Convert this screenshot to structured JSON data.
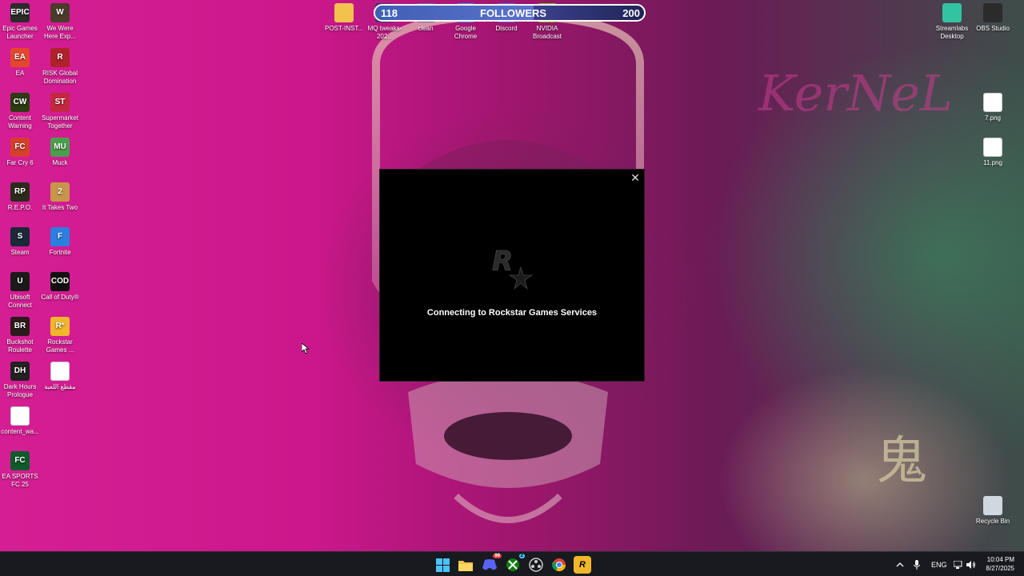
{
  "desktop": {
    "left_icons": [
      {
        "label": "Epic Games Launcher",
        "name": "epic-games-launcher-icon",
        "badge": "EPIC",
        "color": "#2b2b2b"
      },
      {
        "label": "We Were Here Exp...",
        "name": "we-were-here-icon",
        "badge": "W",
        "color": "#4a3b2b"
      },
      {
        "label": "EA",
        "name": "ea-icon",
        "badge": "EA",
        "color": "#e4472e"
      },
      {
        "label": "RISK Global Domination",
        "name": "risk-icon",
        "badge": "R",
        "color": "#b0222b"
      },
      {
        "label": "Content Warning",
        "name": "content-warning-icon",
        "badge": "CW",
        "color": "#2b3b12"
      },
      {
        "label": "Supermarket Together",
        "name": "supermarket-together-icon",
        "badge": "ST",
        "color": "#c42840"
      },
      {
        "label": "Far Cry 6",
        "name": "far-cry-6-icon",
        "badge": "FC",
        "color": "#d6402b"
      },
      {
        "label": "Muck",
        "name": "muck-icon",
        "badge": "MU",
        "color": "#4aa04a"
      },
      {
        "label": "R.E.P.O.",
        "name": "repo-icon",
        "badge": "RP",
        "color": "#2b2b1b"
      },
      {
        "label": "It Takes Two",
        "name": "it-takes-two-icon",
        "badge": "2",
        "color": "#c8964a"
      },
      {
        "label": "Steam",
        "name": "steam-icon",
        "badge": "S",
        "color": "#1b2838"
      },
      {
        "label": "Fortnite",
        "name": "fortnite-icon",
        "badge": "F",
        "color": "#2a7fe0"
      },
      {
        "label": "Ubisoft Connect",
        "name": "ubisoft-connect-icon",
        "badge": "U",
        "color": "#1a1a1a"
      },
      {
        "label": "Call of Duty®",
        "name": "call-of-duty-icon",
        "badge": "COD",
        "color": "#111111"
      },
      {
        "label": "Buckshot Roulette",
        "name": "buckshot-roulette-icon",
        "badge": "BR",
        "color": "#2b1b1b"
      },
      {
        "label": "Rockstar Games ...",
        "name": "rockstar-games-icon",
        "badge": "R*",
        "color": "#f2b62b"
      },
      {
        "label": "Dark Hours Prologue",
        "name": "dark-hours-icon",
        "badge": "DH",
        "color": "#222222"
      },
      {
        "label": "مقطع اللعبة",
        "name": "text-file-icon",
        "badge": "",
        "color": "#ffffff"
      },
      {
        "label": "content_wa...",
        "name": "image-file-icon",
        "badge": "",
        "color": "#ffffff"
      },
      {
        "label": "EA SPORTS FC 25",
        "name": "ea-sports-fc-icon",
        "badge": "FC",
        "color": "#0f5a2a"
      }
    ],
    "top_icons": [
      {
        "label": "POST-INST...",
        "name": "post-install-folder-icon",
        "color": "#f2c14e"
      },
      {
        "label": "MQ tweaks-202...",
        "name": "mq-tweaks-icon",
        "color": "#3a3a6a"
      },
      {
        "label": "clean",
        "name": "clean-icon",
        "color": "#6a6a9a"
      },
      {
        "label": "Google Chrome",
        "name": "google-chrome-icon",
        "color": "#4285f4"
      },
      {
        "label": "Discord",
        "name": "discord-icon",
        "color": "#5865f2"
      },
      {
        "label": "NVIDIA Broadcast",
        "name": "nvidia-broadcast-icon",
        "color": "#76b900"
      }
    ],
    "right_icons": [
      {
        "label": "Streamlabs Desktop",
        "name": "streamlabs-icon",
        "color": "#31c3a2"
      },
      {
        "label": "OBS Studio",
        "name": "obs-studio-icon",
        "color": "#2b2b2b"
      },
      {
        "label": "7.png",
        "name": "png-file-icon",
        "color": "#ffffff"
      },
      {
        "label": "11.png",
        "name": "png-file-icon-2",
        "color": "#ffffff"
      },
      {
        "label": "Recycle Bin",
        "name": "recycle-bin-icon",
        "color": "#cfd8e0"
      }
    ],
    "wallpaper_text": "KerNeL",
    "wallpaper_kanji": "鬼"
  },
  "follower_goal": {
    "current": "118",
    "label": "FOLLOWERS",
    "goal": "200",
    "progress": 0.59
  },
  "dialog": {
    "message": "Connecting to Rockstar Games Services",
    "close_glyph": "✕"
  },
  "taskbar": {
    "language": "ENG",
    "time": "10:04 PM",
    "date": "8/27/2025",
    "discord_badge": "99",
    "xbox_badge": "2"
  },
  "colors": {
    "accent_rockstar": "#f2b62b",
    "taskbar_bg": "#181a20"
  }
}
